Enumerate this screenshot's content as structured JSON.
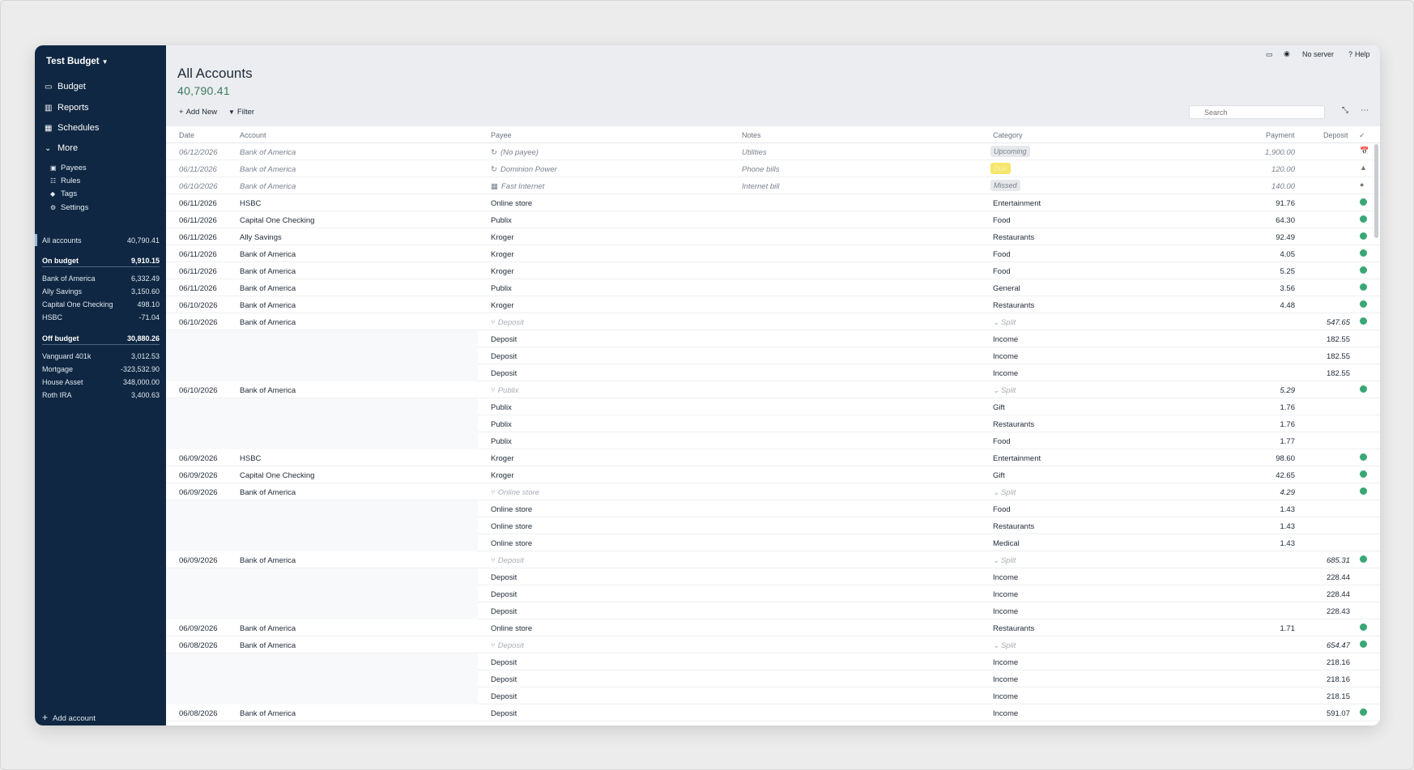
{
  "sidebar": {
    "budget_name": "Test Budget",
    "nav": [
      {
        "label": "Budget",
        "icon": "wallet-icon"
      },
      {
        "label": "Reports",
        "icon": "chart-icon"
      },
      {
        "label": "Schedules",
        "icon": "calendar-icon"
      },
      {
        "label": "More",
        "icon": "chevron-down-icon"
      }
    ],
    "more_items": [
      {
        "label": "Payees",
        "icon": "payees-icon"
      },
      {
        "label": "Rules",
        "icon": "rules-icon"
      },
      {
        "label": "Tags",
        "icon": "tag-icon"
      },
      {
        "label": "Settings",
        "icon": "gear-icon"
      }
    ],
    "all_accounts": {
      "label": "All accounts",
      "amount": "40,790.41"
    },
    "on_budget": {
      "label": "On budget",
      "amount": "9,910.15"
    },
    "on_budget_accounts": [
      {
        "name": "Bank of America",
        "amount": "6,332.49"
      },
      {
        "name": "Ally Savings",
        "amount": "3,150.60"
      },
      {
        "name": "Capital One Checking",
        "amount": "498.10"
      },
      {
        "name": "HSBC",
        "amount": "-71.04"
      }
    ],
    "off_budget": {
      "label": "Off budget",
      "amount": "30,880.26"
    },
    "off_budget_accounts": [
      {
        "name": "Vanguard 401k",
        "amount": "3,012.53"
      },
      {
        "name": "Mortgage",
        "amount": "-323,532.90"
      },
      {
        "name": "House Asset",
        "amount": "348,000.00"
      },
      {
        "name": "Roth IRA",
        "amount": "3,400.63"
      }
    ],
    "add_account": "Add account"
  },
  "header": {
    "title": "All Accounts",
    "balance": "40,790.41",
    "add_new": "Add New",
    "filter": "Filter",
    "search_placeholder": "Search",
    "no_server": "No server",
    "help": "Help"
  },
  "columns": {
    "date": "Date",
    "account": "Account",
    "payee": "Payee",
    "notes": "Notes",
    "category": "Category",
    "payment": "Payment",
    "deposit": "Deposit",
    "cleared": "✓"
  },
  "colors": {
    "sidebar_bg": "#0f2742",
    "cleared": "#3aa676",
    "balance": "#3b7a5c"
  },
  "rows": [
    {
      "type": "sched",
      "date": "06/12/2026",
      "account": "Bank of America",
      "payee": "(No payee)",
      "payee_icon": "↻",
      "notes": "Utilities",
      "badge": "Upcoming",
      "badge_style": "gray",
      "payment": "1,900.00",
      "deposit": "",
      "status": "📅"
    },
    {
      "type": "sched",
      "date": "06/11/2026",
      "account": "Bank of America",
      "payee": "Dominion Power",
      "payee_icon": "↻",
      "notes": "Phone bills",
      "badge": "Due",
      "badge_style": "yellow",
      "payment": "120.00",
      "deposit": "",
      "status": "▲"
    },
    {
      "type": "sched",
      "date": "06/10/2026",
      "account": "Bank of America",
      "payee": "Fast Internet",
      "payee_icon": "▦",
      "notes": "Internet bill",
      "badge": "Missed",
      "badge_style": "gray",
      "payment": "140.00",
      "deposit": "",
      "status": "●"
    },
    {
      "type": "tx",
      "date": "06/11/2026",
      "account": "HSBC",
      "payee": "Online store",
      "category": "Entertainment",
      "payment": "91.76",
      "deposit": ""
    },
    {
      "type": "tx",
      "date": "06/11/2026",
      "account": "Capital One Checking",
      "payee": "Publix",
      "category": "Food",
      "payment": "64.30",
      "deposit": ""
    },
    {
      "type": "tx",
      "date": "06/11/2026",
      "account": "Ally Savings",
      "payee": "Kroger",
      "category": "Restaurants",
      "payment": "92.49",
      "deposit": ""
    },
    {
      "type": "tx",
      "date": "06/11/2026",
      "account": "Bank of America",
      "payee": "Kroger",
      "category": "Food",
      "payment": "4.05",
      "deposit": ""
    },
    {
      "type": "tx",
      "date": "06/11/2026",
      "account": "Bank of America",
      "payee": "Kroger",
      "category": "Food",
      "payment": "5.25",
      "deposit": ""
    },
    {
      "type": "tx",
      "date": "06/11/2026",
      "account": "Bank of America",
      "payee": "Publix",
      "category": "General",
      "payment": "3.56",
      "deposit": ""
    },
    {
      "type": "tx",
      "date": "06/10/2026",
      "account": "Bank of America",
      "payee": "Kroger",
      "category": "Restaurants",
      "payment": "4.48",
      "deposit": ""
    },
    {
      "type": "parent",
      "date": "06/10/2026",
      "account": "Bank of America",
      "payee": "Deposit",
      "category": "Split",
      "payment": "",
      "deposit": "547.65"
    },
    {
      "type": "sub",
      "payee": "Deposit",
      "category": "Income",
      "payment": "",
      "deposit": "182.55"
    },
    {
      "type": "sub",
      "payee": "Deposit",
      "category": "Income",
      "payment": "",
      "deposit": "182.55"
    },
    {
      "type": "sub",
      "payee": "Deposit",
      "category": "Income",
      "payment": "",
      "deposit": "182.55"
    },
    {
      "type": "parent",
      "date": "06/10/2026",
      "account": "Bank of America",
      "payee": "Publix",
      "category": "Split",
      "payment": "5.29",
      "deposit": ""
    },
    {
      "type": "sub",
      "payee": "Publix",
      "category": "Gift",
      "payment": "1.76",
      "deposit": ""
    },
    {
      "type": "sub",
      "payee": "Publix",
      "category": "Restaurants",
      "payment": "1.76",
      "deposit": ""
    },
    {
      "type": "sub",
      "payee": "Publix",
      "category": "Food",
      "payment": "1.77",
      "deposit": ""
    },
    {
      "type": "tx",
      "date": "06/09/2026",
      "account": "HSBC",
      "payee": "Kroger",
      "category": "Entertainment",
      "payment": "98.60",
      "deposit": ""
    },
    {
      "type": "tx",
      "date": "06/09/2026",
      "account": "Capital One Checking",
      "payee": "Kroger",
      "category": "Gift",
      "payment": "42.65",
      "deposit": ""
    },
    {
      "type": "parent",
      "date": "06/09/2026",
      "account": "Bank of America",
      "payee": "Online store",
      "category": "Split",
      "payment": "4.29",
      "deposit": ""
    },
    {
      "type": "sub",
      "payee": "Online store",
      "category": "Food",
      "payment": "1.43",
      "deposit": ""
    },
    {
      "type": "sub",
      "payee": "Online store",
      "category": "Restaurants",
      "payment": "1.43",
      "deposit": ""
    },
    {
      "type": "sub",
      "payee": "Online store",
      "category": "Medical",
      "payment": "1.43",
      "deposit": ""
    },
    {
      "type": "parent",
      "date": "06/09/2026",
      "account": "Bank of America",
      "payee": "Deposit",
      "category": "Split",
      "payment": "",
      "deposit": "685.31"
    },
    {
      "type": "sub",
      "payee": "Deposit",
      "category": "Income",
      "payment": "",
      "deposit": "228.44"
    },
    {
      "type": "sub",
      "payee": "Deposit",
      "category": "Income",
      "payment": "",
      "deposit": "228.44"
    },
    {
      "type": "sub",
      "payee": "Deposit",
      "category": "Income",
      "payment": "",
      "deposit": "228.43"
    },
    {
      "type": "tx",
      "date": "06/09/2026",
      "account": "Bank of America",
      "payee": "Online store",
      "category": "Restaurants",
      "payment": "1.71",
      "deposit": ""
    },
    {
      "type": "parent",
      "date": "06/08/2026",
      "account": "Bank of America",
      "payee": "Deposit",
      "category": "Split",
      "payment": "",
      "deposit": "654.47"
    },
    {
      "type": "sub",
      "payee": "Deposit",
      "category": "Income",
      "payment": "",
      "deposit": "218.16"
    },
    {
      "type": "sub",
      "payee": "Deposit",
      "category": "Income",
      "payment": "",
      "deposit": "218.16"
    },
    {
      "type": "sub",
      "payee": "Deposit",
      "category": "Income",
      "payment": "",
      "deposit": "218.15"
    },
    {
      "type": "tx",
      "date": "06/08/2026",
      "account": "Bank of America",
      "payee": "Deposit",
      "category": "Income",
      "payment": "",
      "deposit": "591.07"
    }
  ]
}
